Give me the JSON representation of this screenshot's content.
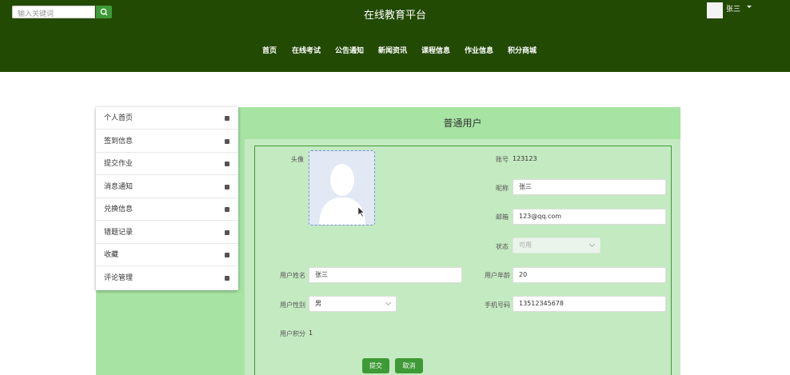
{
  "header": {
    "search_placeholder": "输入关键词",
    "site_title": "在线教育平台",
    "user_name": "张三",
    "nav": [
      "首页",
      "在线考试",
      "公告通知",
      "新闻资讯",
      "课程信息",
      "作业信息",
      "积分商城"
    ]
  },
  "sidebar": {
    "items": [
      "个人首页",
      "签到信息",
      "提交作业",
      "消息通知",
      "兑换信息",
      "错题记录",
      "收藏",
      "评论管理"
    ]
  },
  "main": {
    "title": "普通用户",
    "avatar_label": "头像",
    "account_label": "账号",
    "account_value": "123123",
    "nickname_label": "昵称",
    "nickname_value": "张三",
    "email_label": "邮箱",
    "email_value": "123@qq.com",
    "status_label": "状态",
    "status_value": "可用",
    "realname_label": "用户姓名",
    "realname_value": "张三",
    "age_label": "用户年龄",
    "age_value": "20",
    "gender_label": "用户性别",
    "gender_value": "男",
    "phone_label": "手机号码",
    "phone_value": "13512345678",
    "points_label": "用户积分",
    "points_value": "1",
    "submit_label": "提交",
    "cancel_label": "取消"
  },
  "colors": {
    "header_bg": "#224a03",
    "accent_green": "#3e9a37",
    "panel_green": "#a7e4a3",
    "body_green": "#c4eac1"
  }
}
